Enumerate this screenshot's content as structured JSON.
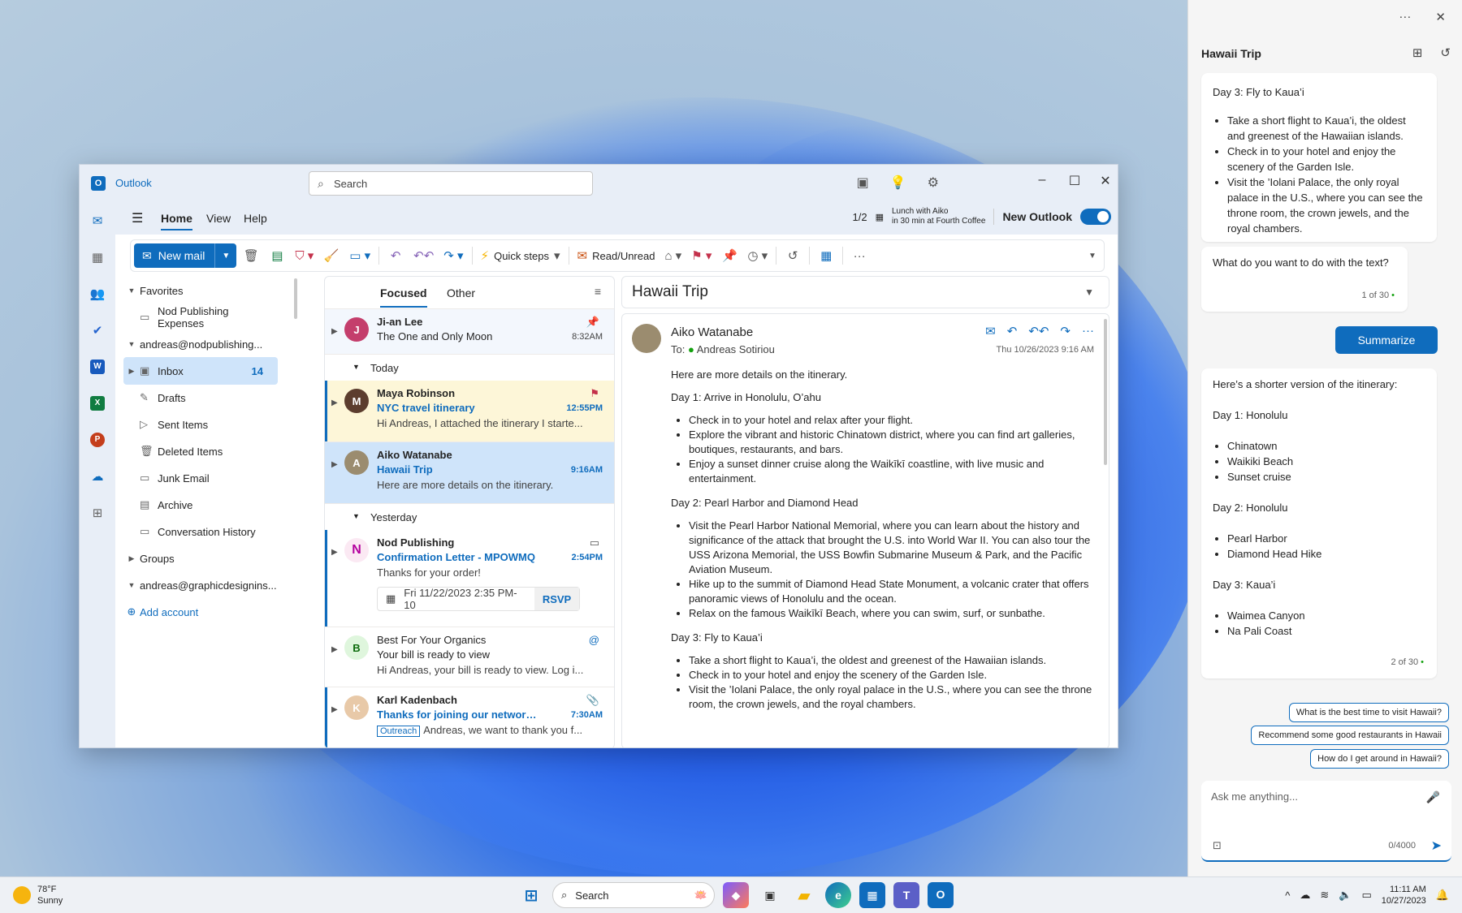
{
  "window": {
    "app_title": "Outlook",
    "search_placeholder": "Search"
  },
  "ribbon": {
    "tabs": [
      "Home",
      "View",
      "Help"
    ],
    "pager": "1/2",
    "reminder_title": "Lunch with Aiko",
    "reminder_sub": "in 30 min at Fourth Coffee",
    "new_outlook_label": "New Outlook",
    "new_outlook_on": true
  },
  "toolbar": {
    "new_mail": "New mail",
    "quick_steps": "Quick steps",
    "read_unread": "Read/Unread",
    "more": "···"
  },
  "folders": {
    "favorites": "Favorites",
    "fav_item": "Nod Publishing Expenses",
    "account1": "andreas@nodpublishing...",
    "inbox": "Inbox",
    "inbox_count": "14",
    "drafts": "Drafts",
    "sent": "Sent Items",
    "deleted": "Deleted Items",
    "junk": "Junk Email",
    "archive": "Archive",
    "conversation": "Conversation History",
    "groups": "Groups",
    "account2": "andreas@graphicdesignins...",
    "add_account": "Add account"
  },
  "list": {
    "tab_focused": "Focused",
    "tab_other": "Other",
    "group_today": "Today",
    "group_yesterday": "Yesterday",
    "m0": {
      "from": "Ji-an Lee",
      "subject": "The One and Only Moon",
      "time": "8:32AM"
    },
    "m1": {
      "from": "Maya Robinson",
      "subject": "NYC travel itinerary",
      "time": "12:55PM",
      "preview": "Hi Andreas, I attached the itinerary I starte..."
    },
    "m2": {
      "from": "Aiko Watanabe",
      "subject": "Hawaii Trip",
      "time": "9:16AM",
      "preview": "Here are more details on the itinerary."
    },
    "m3": {
      "from": "Nod Publishing",
      "subject": "Confirmation Letter - MPOWMQ",
      "time": "2:54PM",
      "preview": "Thanks for your order!",
      "event": "Fri 11/22/2023 2:35 PM-10",
      "rsvp": "RSVP"
    },
    "m4": {
      "from": "Best For Your Organics",
      "subject": "Your bill is ready to view",
      "preview": "Hi Andreas, your bill is ready to view. Log i..."
    },
    "m5": {
      "from": "Karl Kadenbach",
      "subject": "Thanks for joining our networking...",
      "time": "7:30AM",
      "tag": "Outreach",
      "preview": "Andreas, we want to thank you f..."
    }
  },
  "reading": {
    "subject": "Hawaii Trip",
    "from": "Aiko Watanabe",
    "to_label": "To:",
    "to": "Andreas Sotiriou",
    "date": "Thu 10/26/2023 9:16 AM",
    "intro": "Here are more details on the itinerary.",
    "day1_title": "Day 1: Arrive in Honolulu, O’ahu",
    "day1": [
      "Check in to your hotel and relax after your flight.",
      "Explore the vibrant and historic Chinatown district, where you can find art galleries, boutiques, restaurants, and bars.",
      "Enjoy a sunset dinner cruise along the Waikīkī coastline, with live music and entertainment."
    ],
    "day2_title": "Day 2: Pearl Harbor and Diamond Head",
    "day2": [
      "Visit the Pearl Harbor National Memorial, where you can learn about the history and significance of the attack that brought the U.S. into World War II. You can also tour the USS Arizona Memorial, the USS Bowfin Submarine Museum & Park, and the Pacific Aviation Museum.",
      "Hike up to the summit of Diamond Head State Monument, a volcanic crater that offers panoramic views of Honolulu and the ocean.",
      "Relax on the famous Waikīkī Beach, where you can swim, surf, or sunbathe."
    ],
    "day3_title": "Day 3: Fly to Kaua’i",
    "day3": [
      "Take a short flight to Kaua’i, the oldest and greenest of the Hawaiian islands.",
      "Check in to your hotel and enjoy the scenery of the Garden Isle.",
      "Visit the ’Iolani Palace, the only royal palace in the U.S., where you can see the throne room, the crown jewels, and the royal chambers."
    ]
  },
  "copilot": {
    "title": "Hawaii Trip",
    "card1_title": "Day 3: Fly to Kaua’i",
    "card1_items": [
      "Take a short flight to Kaua’i, the oldest and greenest of the Hawaiian islands.",
      "Check in to your hotel and enjoy the scenery of the Garden Isle.",
      "Visit the ’Iolani Palace, the only royal palace in the U.S., where you can see the throne room, the crown jewels, and the royal chambers."
    ],
    "card2_text": "What do you want to do with the text?",
    "card2_page": "1 of 30",
    "summarize": "Summarize",
    "card3_intro": "Here’s a shorter version of the itinerary:",
    "card3_d1": "Day 1: Honolulu",
    "card3_d1_items": [
      "Chinatown",
      "Waikiki Beach",
      "Sunset cruise"
    ],
    "card3_d2": "Day 2: Honolulu",
    "card3_d2_items": [
      "Pearl Harbor",
      "Diamond Head Hike"
    ],
    "card3_d3": "Day 3: Kaua’i",
    "card3_d3_items": [
      "Waimea Canyon",
      "Na Pali Coast"
    ],
    "card3_page": "2 of 30",
    "suggestions": [
      "What is the best time to visit Hawaii?",
      "Recommend some good restaurants in Hawaii",
      "How do I get around in Hawaii?"
    ],
    "ask_placeholder": "Ask me anything...",
    "char_count": "0/4000"
  },
  "taskbar": {
    "temp": "78°F",
    "condition": "Sunny",
    "search": "Search",
    "time": "11:11 AM",
    "date": "10/27/2023"
  }
}
